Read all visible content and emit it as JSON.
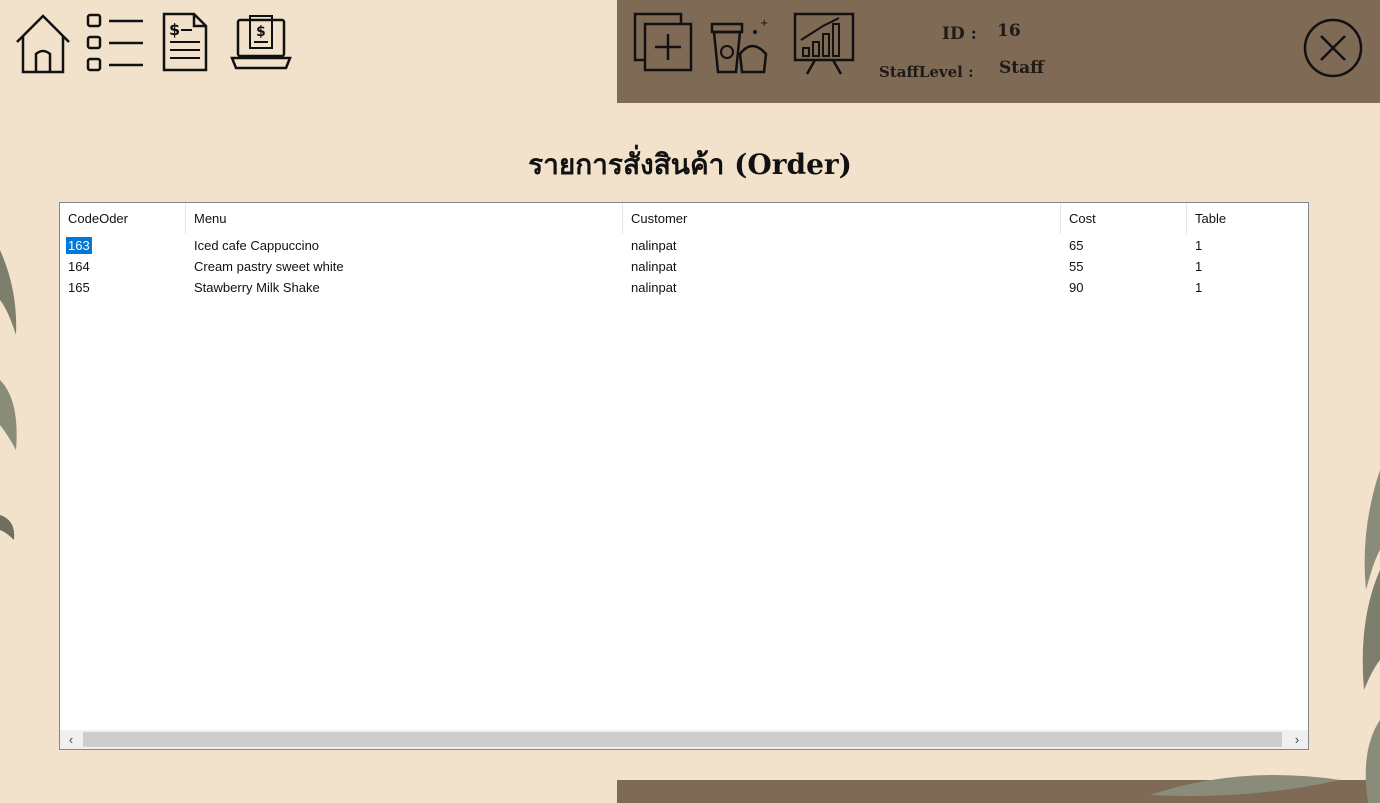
{
  "toolbar": {
    "left_icons": [
      "home-icon",
      "checklist-icon",
      "invoice-icon",
      "receipt-laptop-icon"
    ],
    "right_icons": [
      "add-icon",
      "coffee-cupcake-icon",
      "growth-chart-icon",
      "close-icon"
    ]
  },
  "staff": {
    "id_label": "ID :",
    "id_value": "16",
    "level_label": "StaffLevel :",
    "level_value": "Staff"
  },
  "page": {
    "title": "รายการสั่งสินค้า (Order)"
  },
  "table": {
    "columns": [
      "CodeOder",
      "Menu",
      "Customer",
      "Cost",
      "Table"
    ],
    "rows": [
      {
        "code": "163",
        "menu": "Iced cafe Cappuccino",
        "customer": "nalinpat",
        "cost": "65",
        "table": "1"
      },
      {
        "code": "164",
        "menu": "Cream pastry sweet white",
        "customer": "nalinpat",
        "cost": "55",
        "table": "1"
      },
      {
        "code": "165",
        "menu": "Stawberry Milk Shake",
        "customer": "nalinpat",
        "cost": "90",
        "table": "1"
      }
    ],
    "scroll_left": "‹",
    "scroll_right": "›"
  },
  "colors": {
    "background": "#f2e2cb",
    "banner_brown": "#7f6a55",
    "selection": "#0078d7"
  }
}
